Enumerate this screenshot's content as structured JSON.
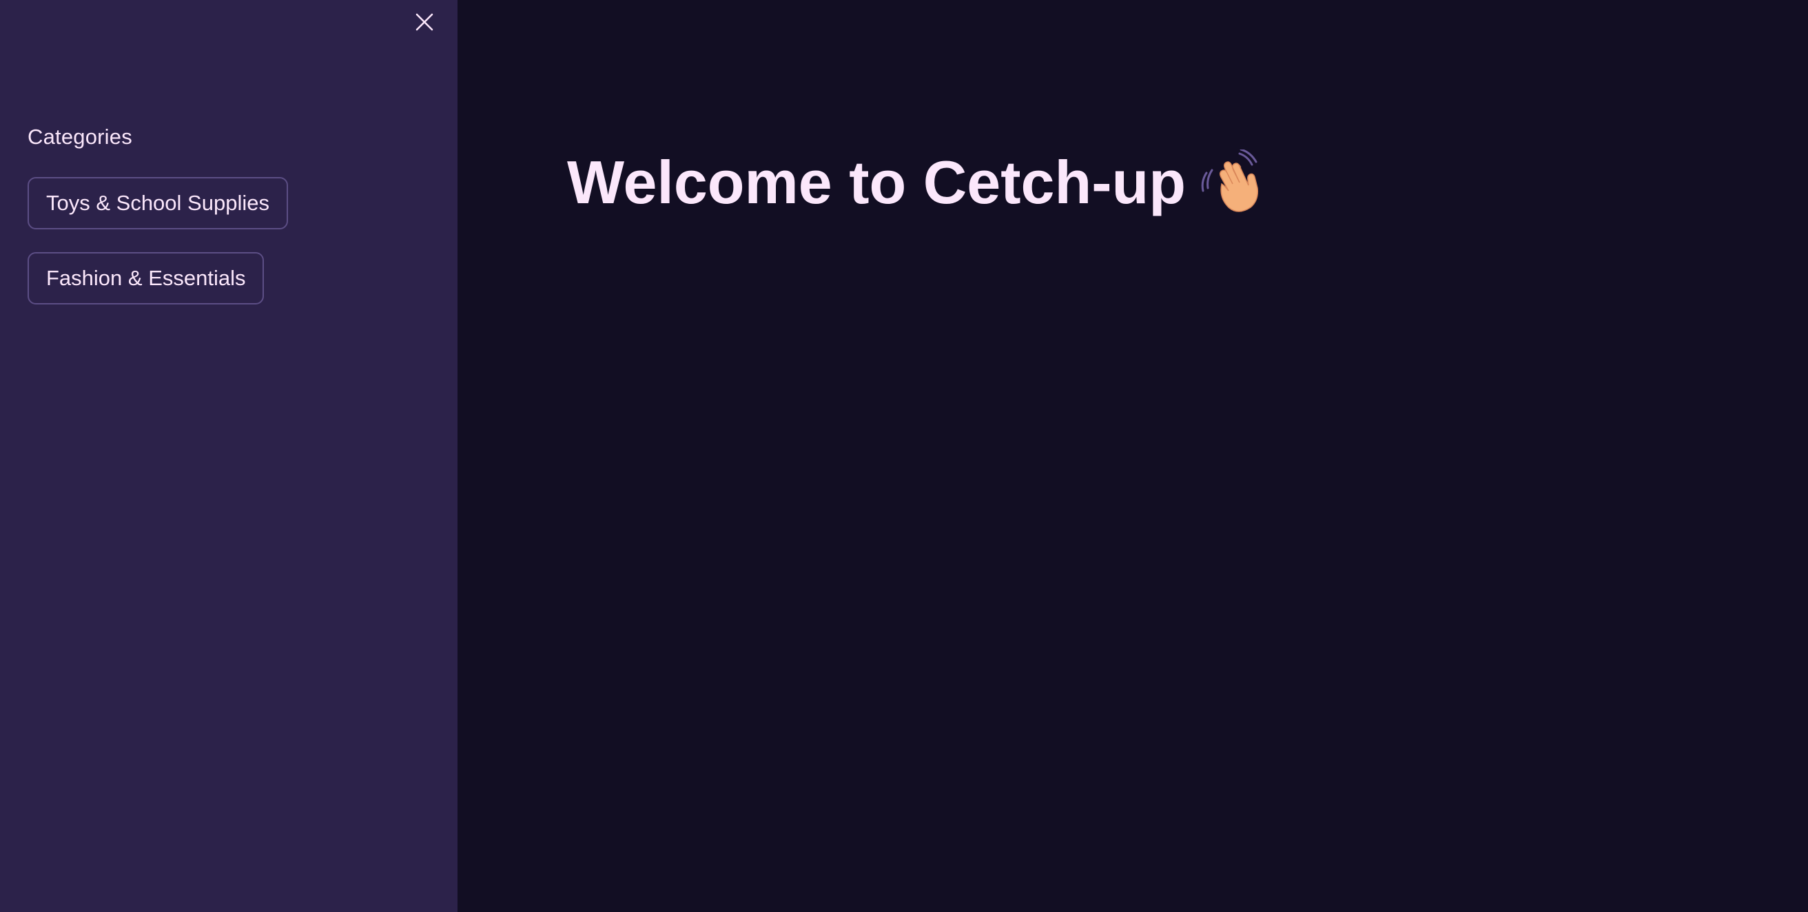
{
  "sidebar": {
    "close_icon": "close-icon",
    "heading": "Categories",
    "categories": [
      {
        "label": "Toys & School Supplies"
      },
      {
        "label": "Fashion & Essentials"
      }
    ]
  },
  "main": {
    "title": "Welcome to Cetch-up",
    "title_icon": "waving-hand-icon"
  },
  "colors": {
    "sidebar_bg": "#2c224a",
    "main_bg": "#120e23",
    "text": "#fbe7fb",
    "button_border": "#5c4e85"
  }
}
